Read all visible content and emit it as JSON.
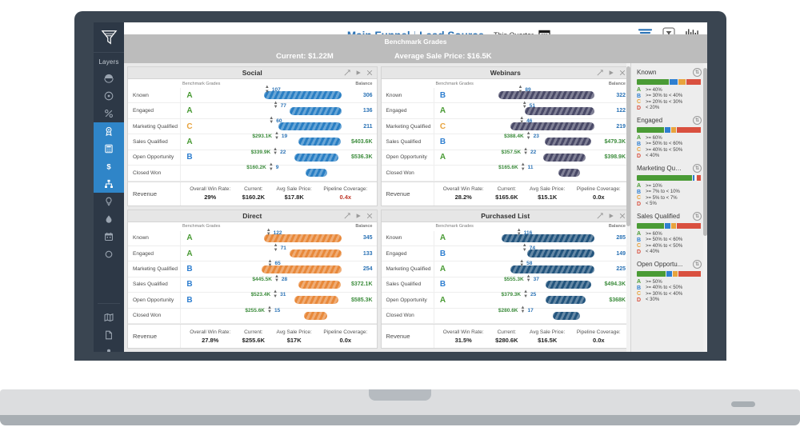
{
  "header": {
    "title_main": "Main Funnel",
    "title_sep": "|",
    "title_sub": "Lead Source",
    "quarter_label": "This Quarter",
    "calendar_icon": "calendar-icon",
    "icons": [
      "sort-descending-icon",
      "filter-icon",
      "chart-bars-icon"
    ]
  },
  "kpis": {
    "current": "Current: $1.22M",
    "avg_sale_price": "Average Sale Price: $16.5K"
  },
  "rail": {
    "logo": "funnel-logo-icon",
    "label": "Layers",
    "items": [
      {
        "name": "sidebar-item-half-circle",
        "icon": "half-circle-icon",
        "active": false
      },
      {
        "name": "sidebar-item-target",
        "icon": "target-icon",
        "active": false
      },
      {
        "name": "sidebar-item-percent",
        "icon": "percent-icon",
        "active": false
      },
      {
        "name": "sidebar-item-award",
        "icon": "award-icon",
        "active": true
      },
      {
        "name": "sidebar-item-calculator",
        "icon": "calculator-icon",
        "active": true
      },
      {
        "name": "sidebar-item-dollar",
        "icon": "dollar-icon",
        "active": true
      },
      {
        "name": "sidebar-item-org-chart",
        "icon": "org-chart-icon",
        "active": true
      },
      {
        "name": "sidebar-item-bulb",
        "icon": "lightbulb-icon",
        "active": false
      },
      {
        "name": "sidebar-item-drop",
        "icon": "water-drop-icon",
        "active": false
      },
      {
        "name": "sidebar-item-calendar",
        "icon": "calendar-icon",
        "active": false
      },
      {
        "name": "sidebar-item-circle",
        "icon": "circle-icon",
        "active": false
      }
    ],
    "bottom_items": [
      {
        "name": "sidebar-item-map",
        "icon": "map-icon"
      },
      {
        "name": "sidebar-item-document",
        "icon": "document-icon"
      },
      {
        "name": "sidebar-item-user",
        "icon": "user-icon"
      },
      {
        "name": "sidebar-item-logout",
        "icon": "logout-icon"
      }
    ]
  },
  "panel_controls": [
    "expand-icon",
    "play-icon",
    "close-icon"
  ],
  "column_headers": {
    "benchmark": "Benchmark Grades",
    "balance": "Balance"
  },
  "stages": [
    "Known",
    "Engaged",
    "Marketing Qualified",
    "Sales Qualified",
    "Open Opportunity",
    "Closed Won"
  ],
  "revenue_row_label": "Revenue",
  "revenue_labels": {
    "win_rate": "Overall Win Rate:",
    "current": "Current:",
    "avg_price": "Avg Sale Price:",
    "coverage": "Pipeline Coverage:"
  },
  "chart_data": {
    "type": "bar",
    "title": "Main Funnel | Lead Source",
    "panels": [
      {
        "title": "Social",
        "color": "#2a7fc4",
        "rows": [
          {
            "stage": "Known",
            "grade": "A",
            "count": "107",
            "money": "",
            "balance": "306",
            "balance_kind": "blue",
            "width": 58,
            "center": 52
          },
          {
            "stage": "Engaged",
            "grade": "A",
            "count": "77",
            "money": "",
            "balance": "136",
            "balance_kind": "blue",
            "width": 50,
            "center": 57
          },
          {
            "stage": "Marketing Qualified",
            "grade": "C",
            "count": "60",
            "money": "",
            "balance": "211",
            "balance_kind": "blue",
            "width": 52,
            "center": 54
          },
          {
            "stage": "Sales Qualified",
            "grade": "A",
            "count": "19",
            "money": "$293.1K",
            "balance": "$403.6K",
            "balance_kind": "green",
            "width": 30,
            "center": 50
          },
          {
            "stage": "Open Opportunity",
            "grade": "B",
            "count": "22",
            "money": "$339.9K",
            "balance": "$536.3K",
            "balance_kind": "green",
            "width": 31,
            "center": 49
          },
          {
            "stage": "Closed Won",
            "grade": "",
            "count": "9",
            "money": "$160.2K",
            "balance": "",
            "balance_kind": "",
            "width": 15,
            "center": 45
          }
        ],
        "revenue": {
          "win_rate": "29%",
          "current": "$160.2K",
          "avg_price": "$17.8K",
          "coverage": "0.4x",
          "coverage_warn": true
        }
      },
      {
        "title": "Webinars",
        "color": "#4a4a68",
        "rows": [
          {
            "stage": "Known",
            "grade": "B",
            "count": "89",
            "money": "",
            "balance": "322",
            "balance_kind": "blue",
            "width": 69,
            "center": 51
          },
          {
            "stage": "Engaged",
            "grade": "A",
            "count": "51",
            "money": "",
            "balance": "122",
            "balance_kind": "blue",
            "width": 57,
            "center": 54
          },
          {
            "stage": "Marketing Qualified",
            "grade": "C",
            "count": "46",
            "money": "",
            "balance": "219",
            "balance_kind": "blue",
            "width": 63,
            "center": 52
          },
          {
            "stage": "Sales Qualified",
            "grade": "B",
            "count": "23",
            "money": "$388.4K",
            "balance": "$479.3K",
            "balance_kind": "green",
            "width": 33,
            "center": 49
          },
          {
            "stage": "Open Opportunity",
            "grade": "A",
            "count": "22",
            "money": "$357.5K",
            "balance": "$398.9K",
            "balance_kind": "green",
            "width": 30,
            "center": 47
          },
          {
            "stage": "Closed Won",
            "grade": "",
            "count": "11",
            "money": "$165.6K",
            "balance": "",
            "balance_kind": "",
            "width": 15,
            "center": 45
          }
        ],
        "revenue": {
          "win_rate": "28.2%",
          "current": "$165.6K",
          "avg_price": "$15.1K",
          "coverage": "0.0x",
          "coverage_warn": false
        }
      },
      {
        "title": "Direct",
        "color": "#e8893b",
        "rows": [
          {
            "stage": "Known",
            "grade": "A",
            "count": "122",
            "money": "",
            "balance": "345",
            "balance_kind": "blue",
            "width": 60,
            "center": 53
          },
          {
            "stage": "Engaged",
            "grade": "A",
            "count": "71",
            "money": "",
            "balance": "133",
            "balance_kind": "blue",
            "width": 50,
            "center": 57
          },
          {
            "stage": "Marketing Qualified",
            "grade": "B",
            "count": "65",
            "money": "",
            "balance": "254",
            "balance_kind": "blue",
            "width": 62,
            "center": 53
          },
          {
            "stage": "Sales Qualified",
            "grade": "B",
            "count": "28",
            "money": "$445.5K",
            "balance": "$372.1K",
            "balance_kind": "green",
            "width": 30,
            "center": 50
          },
          {
            "stage": "Open Opportunity",
            "grade": "B",
            "count": "31",
            "money": "$523.4K",
            "balance": "$585.3K",
            "balance_kind": "green",
            "width": 31,
            "center": 49
          },
          {
            "stage": "Closed Won",
            "grade": "",
            "count": "15",
            "money": "$255.6K",
            "balance": "",
            "balance_kind": "",
            "width": 16,
            "center": 45
          }
        ],
        "revenue": {
          "win_rate": "27.8%",
          "current": "$255.6K",
          "avg_price": "$17K",
          "coverage": "0.0x",
          "coverage_warn": false
        }
      },
      {
        "title": "Purchased List",
        "color": "#23557e",
        "rows": [
          {
            "stage": "Known",
            "grade": "A",
            "count": "116",
            "money": "",
            "balance": "285",
            "balance_kind": "blue",
            "width": 67,
            "center": 51
          },
          {
            "stage": "Engaged",
            "grade": "B",
            "count": "74",
            "money": "",
            "balance": "149",
            "balance_kind": "blue",
            "width": 55,
            "center": 54
          },
          {
            "stage": "Marketing Qualified",
            "grade": "A",
            "count": "58",
            "money": "",
            "balance": "225",
            "balance_kind": "blue",
            "width": 63,
            "center": 52
          },
          {
            "stage": "Sales Qualified",
            "grade": "B",
            "count": "37",
            "money": "$555.3K",
            "balance": "$494.3K",
            "balance_kind": "green",
            "width": 32,
            "center": 49
          },
          {
            "stage": "Open Opportunity",
            "grade": "A",
            "count": "25",
            "money": "$379.3K",
            "balance": "$368K",
            "balance_kind": "green",
            "width": 28,
            "center": 47
          },
          {
            "stage": "Closed Won",
            "grade": "",
            "count": "17",
            "money": "$280.6K",
            "balance": "",
            "balance_kind": "",
            "width": 19,
            "center": 45
          }
        ],
        "revenue": {
          "win_rate": "31.5%",
          "current": "$280.6K",
          "avg_price": "$16.5K",
          "coverage": "0.0x",
          "coverage_warn": false
        }
      }
    ]
  },
  "benchmark": {
    "title": "Benchmark Grades",
    "sort_icon": "sort-icon",
    "groups": [
      {
        "name": "Known",
        "meter": [
          {
            "color": "#4a9b35",
            "pct": 52
          },
          {
            "color": "#2f7fd0",
            "pct": 13
          },
          {
            "color": "#e8a33d",
            "pct": 12
          },
          {
            "color": "#d9503f",
            "pct": 23
          }
        ],
        "rows": [
          {
            "grade": "A",
            "range": ">= 40%"
          },
          {
            "grade": "B",
            "range": ">= 30% to < 40%"
          },
          {
            "grade": "C",
            "range": ">= 20% to < 30%"
          },
          {
            "grade": "D",
            "range": "< 20%"
          }
        ]
      },
      {
        "name": "Engaged",
        "meter": [
          {
            "color": "#4a9b35",
            "pct": 44
          },
          {
            "color": "#2f7fd0",
            "pct": 9
          },
          {
            "color": "#e8a33d",
            "pct": 8
          },
          {
            "color": "#d9503f",
            "pct": 39
          }
        ],
        "rows": [
          {
            "grade": "A",
            "range": ">= 60%"
          },
          {
            "grade": "B",
            "range": ">= 50% to < 60%"
          },
          {
            "grade": "C",
            "range": ">= 40% to < 50%"
          },
          {
            "grade": "D",
            "range": "< 40%"
          }
        ]
      },
      {
        "name": "Marketing Qua...",
        "meter": [
          {
            "color": "#4a9b35",
            "pct": 89
          },
          {
            "color": "#2f7fd0",
            "pct": 3
          },
          {
            "color": "#ffffff",
            "pct": 2
          },
          {
            "color": "#d9503f",
            "pct": 6
          }
        ],
        "rows": [
          {
            "grade": "A",
            "range": ">= 10%"
          },
          {
            "grade": "B",
            "range": ">= 7% to < 10%"
          },
          {
            "grade": "C",
            "range": ">= 5% to < 7%"
          },
          {
            "grade": "D",
            "range": "< 5%"
          }
        ]
      },
      {
        "name": "Sales Qualified",
        "meter": [
          {
            "color": "#4a9b35",
            "pct": 44
          },
          {
            "color": "#2f7fd0",
            "pct": 9
          },
          {
            "color": "#e8a33d",
            "pct": 8
          },
          {
            "color": "#d9503f",
            "pct": 39
          }
        ],
        "rows": [
          {
            "grade": "A",
            "range": ">= 60%"
          },
          {
            "grade": "B",
            "range": ">= 50% to < 60%"
          },
          {
            "grade": "C",
            "range": ">= 40% to < 50%"
          },
          {
            "grade": "D",
            "range": "< 40%"
          }
        ]
      },
      {
        "name": "Open Opportu...",
        "meter": [
          {
            "color": "#4a9b35",
            "pct": 47
          },
          {
            "color": "#2f7fd0",
            "pct": 9
          },
          {
            "color": "#e8a33d",
            "pct": 8
          },
          {
            "color": "#d9503f",
            "pct": 36
          }
        ],
        "rows": [
          {
            "grade": "A",
            "range": ">= 50%"
          },
          {
            "grade": "B",
            "range": ">= 40% to < 50%"
          },
          {
            "grade": "C",
            "range": ">= 30% to < 40%"
          },
          {
            "grade": "D",
            "range": "< 30%"
          }
        ]
      }
    ]
  }
}
